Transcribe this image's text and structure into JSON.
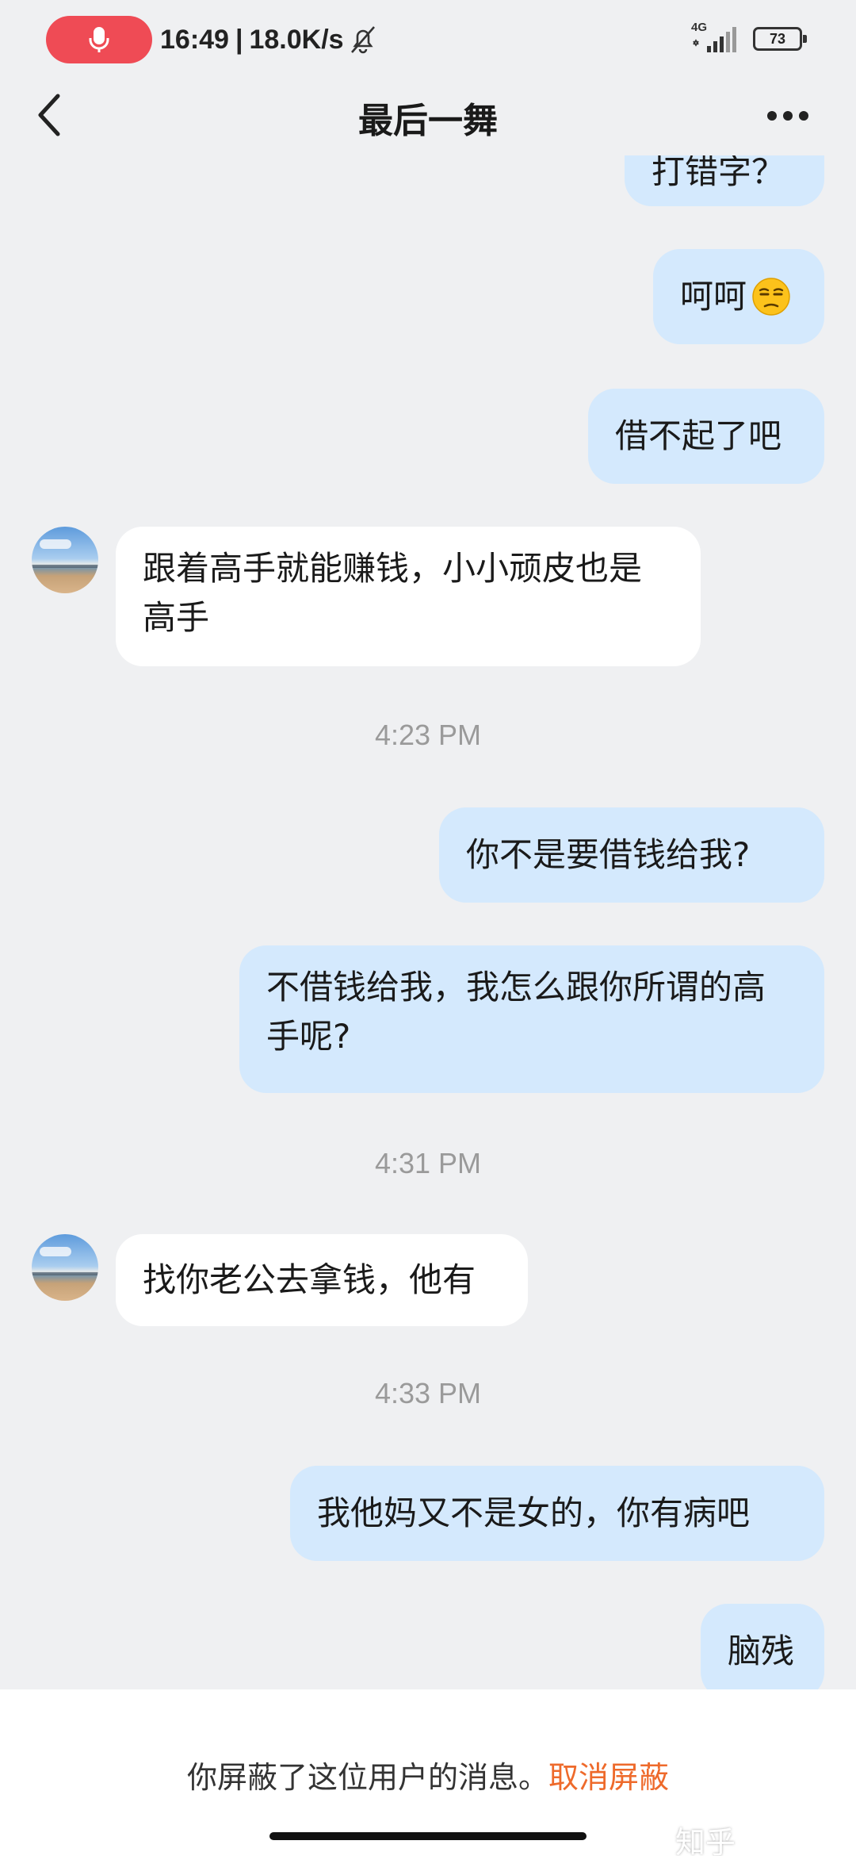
{
  "status_bar": {
    "time": "16:49",
    "separator": "|",
    "speed": "18.0K/s",
    "network": "4G",
    "battery": "73"
  },
  "header": {
    "title": "最后一舞"
  },
  "messages": [
    {
      "from": "me",
      "text": "打错字？"
    },
    {
      "from": "me",
      "text": "呵呵",
      "emoji": "unamused-face"
    },
    {
      "from": "me",
      "text": "借不起了吧"
    },
    {
      "from": "them",
      "text": "跟着高手就能赚钱，小小顽皮也是高手"
    },
    {
      "from": "me",
      "text": "你不是要借钱给我?"
    },
    {
      "from": "me",
      "text": "不借钱给我，我怎么跟你所谓的高手呢?"
    },
    {
      "from": "them",
      "text": "找你老公去拿钱，他有"
    },
    {
      "from": "me",
      "text": "我他妈又不是女的，你有病吧"
    },
    {
      "from": "me",
      "text": "脑残"
    }
  ],
  "timestamps": [
    "4:23 PM",
    "4:31 PM",
    "4:33 PM"
  ],
  "bottom_bar": {
    "notice": "你屏蔽了这位用户的消息。",
    "unblock_label": "取消屏蔽",
    "watermark": "知乎 @yeouttb"
  },
  "colors": {
    "background": "#eff0f2",
    "my_bubble": "#d4e9fd",
    "their_bubble": "#ffffff",
    "accent_orange": "#ee6a2b",
    "mic_red": "#ef4b55"
  }
}
